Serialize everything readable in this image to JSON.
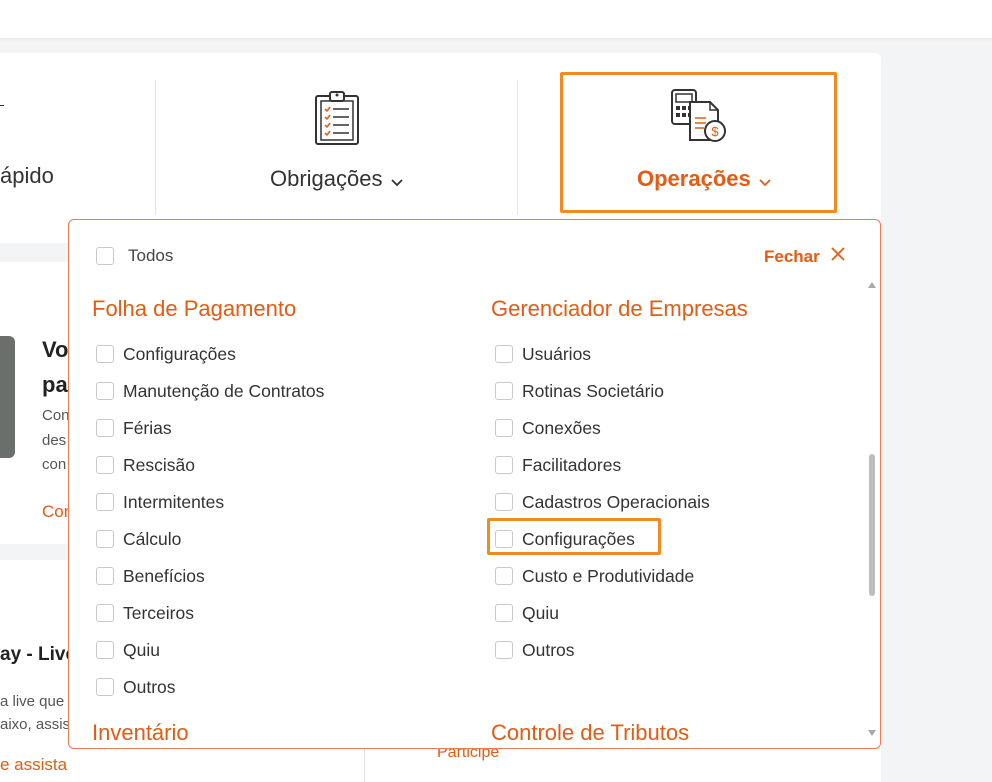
{
  "colors": {
    "accent": "#e55b13",
    "highlight": "#f28a1e"
  },
  "categories": {
    "partial_left": "ápido",
    "obrigacoes": {
      "label": "Obrigações",
      "icon": "clipboard-checklist-icon"
    },
    "operacoes": {
      "label": "Operações",
      "icon": "calculator-document-dollar-icon"
    }
  },
  "background": {
    "card_title": "Vo",
    "card_title2": "pa",
    "card_text": [
      "Con",
      "des",
      "con"
    ],
    "card_link": "Con",
    "live_title": "ay - Live",
    "live_text": [
      "a live que",
      "aixo, assis"
    ],
    "live_link": "e assista",
    "participe": "Participe"
  },
  "panel": {
    "todos_label": "Todos",
    "close_label": "Fechar",
    "sections": [
      {
        "title": "Folha de Pagamento",
        "items": [
          "Configurações",
          "Manutenção de Contratos",
          "Férias",
          "Rescisão",
          "Intermitentes",
          "Cálculo",
          "Benefícios",
          "Terceiros",
          "Quiu",
          "Outros"
        ]
      },
      {
        "title": "Gerenciador de Empresas",
        "items": [
          "Usuários",
          "Rotinas Societário",
          "Conexões",
          "Facilitadores",
          "Cadastros Operacionais",
          "Configurações",
          "Custo e Produtividade",
          "Quiu",
          "Outros"
        ]
      },
      {
        "title": "Inventário",
        "items": []
      },
      {
        "title": "Controle de Tributos",
        "items": []
      }
    ]
  }
}
